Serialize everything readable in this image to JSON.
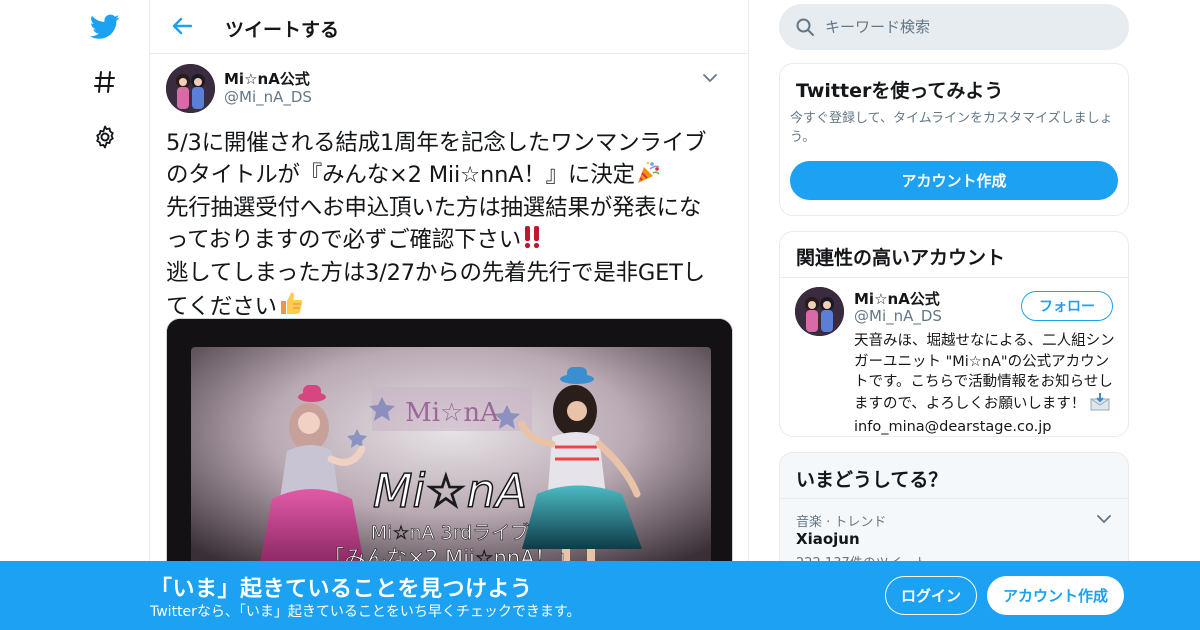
{
  "nav": {
    "icons": [
      "twitter-bird-icon",
      "hashtag-icon",
      "gear-icon"
    ]
  },
  "header": {
    "title": "ツイートする"
  },
  "tweet": {
    "author_name": "Mi☆nA公式",
    "author_handle": "@Mi_nA_DS",
    "lines": [
      "5/3に開催される結成1周年を記念したワンマンライブ",
      "のタイトルが『みんな×2 Mii☆nnA！』に決定",
      "先行抽選受付へお申込頂いた方は抽選結果が発表にな",
      "っておりますので必ずご確認下さい",
      "逃してしまった方は3/27からの先着先行で是非GETし",
      "てください"
    ],
    "media": {
      "banner_text": "Mi☆nA",
      "logo_text": "Mi☆nA",
      "caption_line1": "Mi☆nA 3rdライブ",
      "caption_line2": "「みんな×2 Mii☆nnA！」"
    }
  },
  "search": {
    "placeholder": "キーワード検索"
  },
  "signup_card": {
    "title": "Twitterを使ってみよう",
    "description": "今すぐ登録して、タイムラインをカスタマイズしましょう。",
    "button": "アカウント作成"
  },
  "related_card": {
    "title": "関連性の高いアカウント",
    "account_name": "Mi☆nA公式",
    "account_handle": "@Mi_nA_DS",
    "follow_button": "フォロー",
    "bio": "天音みほ、堀越せなによる、二人組シンガーユニット \"Mi☆nA\"の公式アカウントです。こちらで活動情報をお知らせしますので、よろしくお願いします！",
    "bio_email": "info_mina@dearstage.co.jp"
  },
  "trends_card": {
    "title": "いまどうしてる？",
    "trend_context": "音楽 · トレンド",
    "trend_name": "Xiaojun",
    "trend_count": "222,137件のツイート"
  },
  "bottom_bar": {
    "title": "「いま」起きていることを見つけよう",
    "subtitle": "Twitterなら、「いま」起きていることをいち早くチェックできます。",
    "login_button": "ログイン",
    "signup_button": "アカウント作成"
  },
  "colors": {
    "brand": "#1da1f2",
    "text": "#14171a",
    "secondary_text": "#657786",
    "border": "#e6ecf0"
  }
}
